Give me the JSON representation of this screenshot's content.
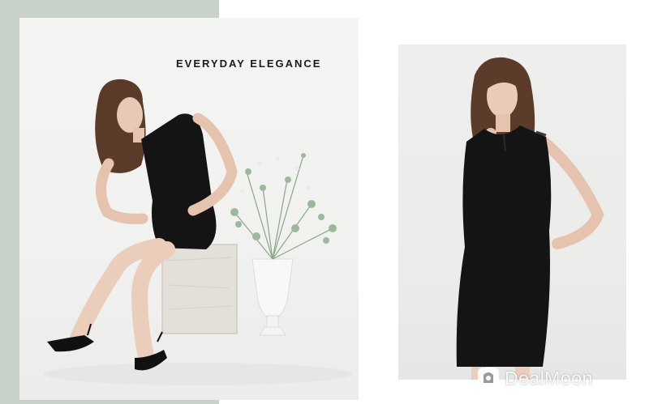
{
  "campaign": {
    "headline": "EVERYDAY ELEGANCE"
  },
  "watermark": {
    "brand": "DealMoon",
    "icon": "dealmoon-logo-icon"
  },
  "colors": {
    "sage_background": "#c9d2ca",
    "studio_backdrop": "#f2f2f1",
    "dress": "#141414"
  }
}
